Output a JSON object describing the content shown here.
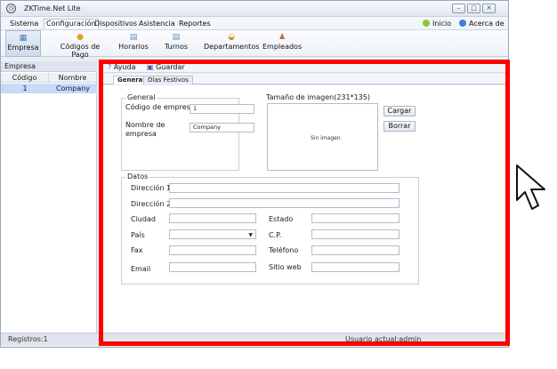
{
  "window": {
    "title": "ZKTime.Net Lite",
    "controls": {
      "minimize": "–",
      "maximize": "□",
      "close": "✕"
    }
  },
  "menubar": {
    "items": [
      "Sistema",
      "Configuración",
      "Dispositivos",
      "Asistencia",
      "Reportes"
    ],
    "active": "Configuración",
    "right": {
      "inicio": "Inicio",
      "acerca": "Acerca de"
    }
  },
  "ribbon": {
    "buttons": [
      "Empresa",
      "Códigos de Pago",
      "Horarios",
      "Turnos",
      "Departamentos",
      "Empleados"
    ],
    "active": "Empresa"
  },
  "left_panel": {
    "title": "Empresa",
    "columns": [
      "Código",
      "Nombre"
    ],
    "rows": [
      {
        "codigo": "1",
        "nombre": "Company"
      }
    ]
  },
  "toolbar": {
    "ayuda": "Ayuda",
    "guardar": "Guardar"
  },
  "tabs": {
    "general": "General",
    "festivos": "Días Festivos"
  },
  "general": {
    "legend": "General",
    "codigo_label": "Código de empresa",
    "codigo_value": "1",
    "nombre_label": "Nombre de empresa",
    "nombre_value": "Company"
  },
  "image": {
    "legend": "Tamaño de imagen(231*135)",
    "placeholder": "Sin imagen",
    "cargar": "Cargar",
    "borrar": "Borrar"
  },
  "datos": {
    "legend": "Datos",
    "direccion1": "Dirección 1",
    "direccion2": "Dirección 2",
    "ciudad": "Ciudad",
    "estado": "Estado",
    "pais": "País",
    "cp": "C.P.",
    "fax": "Fax",
    "telefono": "Teléfono",
    "email": "Email",
    "sitio_web": "Sitio web"
  },
  "status": {
    "registros": "Registros:1",
    "usuario": "Usuario actual:admin"
  },
  "colors": {
    "highlight": "#ff0000",
    "selected_row": "#c8daf5",
    "window_bg": "#e9eef5"
  }
}
